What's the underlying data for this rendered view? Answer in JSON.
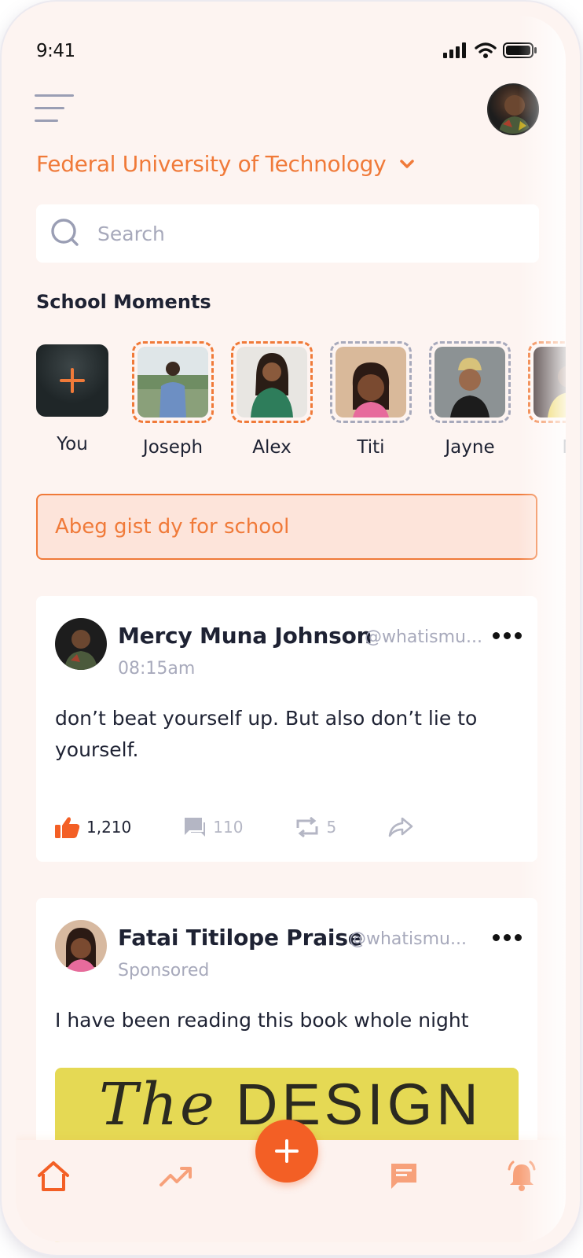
{
  "status_bar": {
    "time": "9:41"
  },
  "header": {
    "school_name": "Federal University of Technology"
  },
  "search": {
    "placeholder": "Search"
  },
  "moments": {
    "title": "School Moments",
    "items": [
      {
        "name": "You"
      },
      {
        "name": "Joseph"
      },
      {
        "name": "Alex"
      },
      {
        "name": "Titi"
      },
      {
        "name": "Jayne"
      },
      {
        "name": "N"
      }
    ]
  },
  "composer": {
    "placeholder": "Abeg gist dy for school"
  },
  "posts": [
    {
      "author": "Mercy Muna Johnson",
      "handle": "@whatismu...",
      "meta": "08:15am",
      "text": "don’t beat yourself up. But also don’t lie to yourself.",
      "likes": "1,210",
      "comments": "110",
      "reposts": "5"
    },
    {
      "author": "Fatai Titilope Praise",
      "handle": "@whatismu...",
      "meta": "Sponsored",
      "text": "I have been reading this book whole night",
      "image_text_1": "The",
      "image_text_2": "DESIGN"
    }
  ],
  "colors": {
    "accent": "#f07a39",
    "fab": "#f35f25",
    "muted": "#a7a9bb",
    "background": "#fdf4f1"
  },
  "icons": {
    "tabs": [
      "home-icon",
      "trending-icon",
      "add-icon",
      "chat-icon",
      "bell-icon"
    ]
  }
}
